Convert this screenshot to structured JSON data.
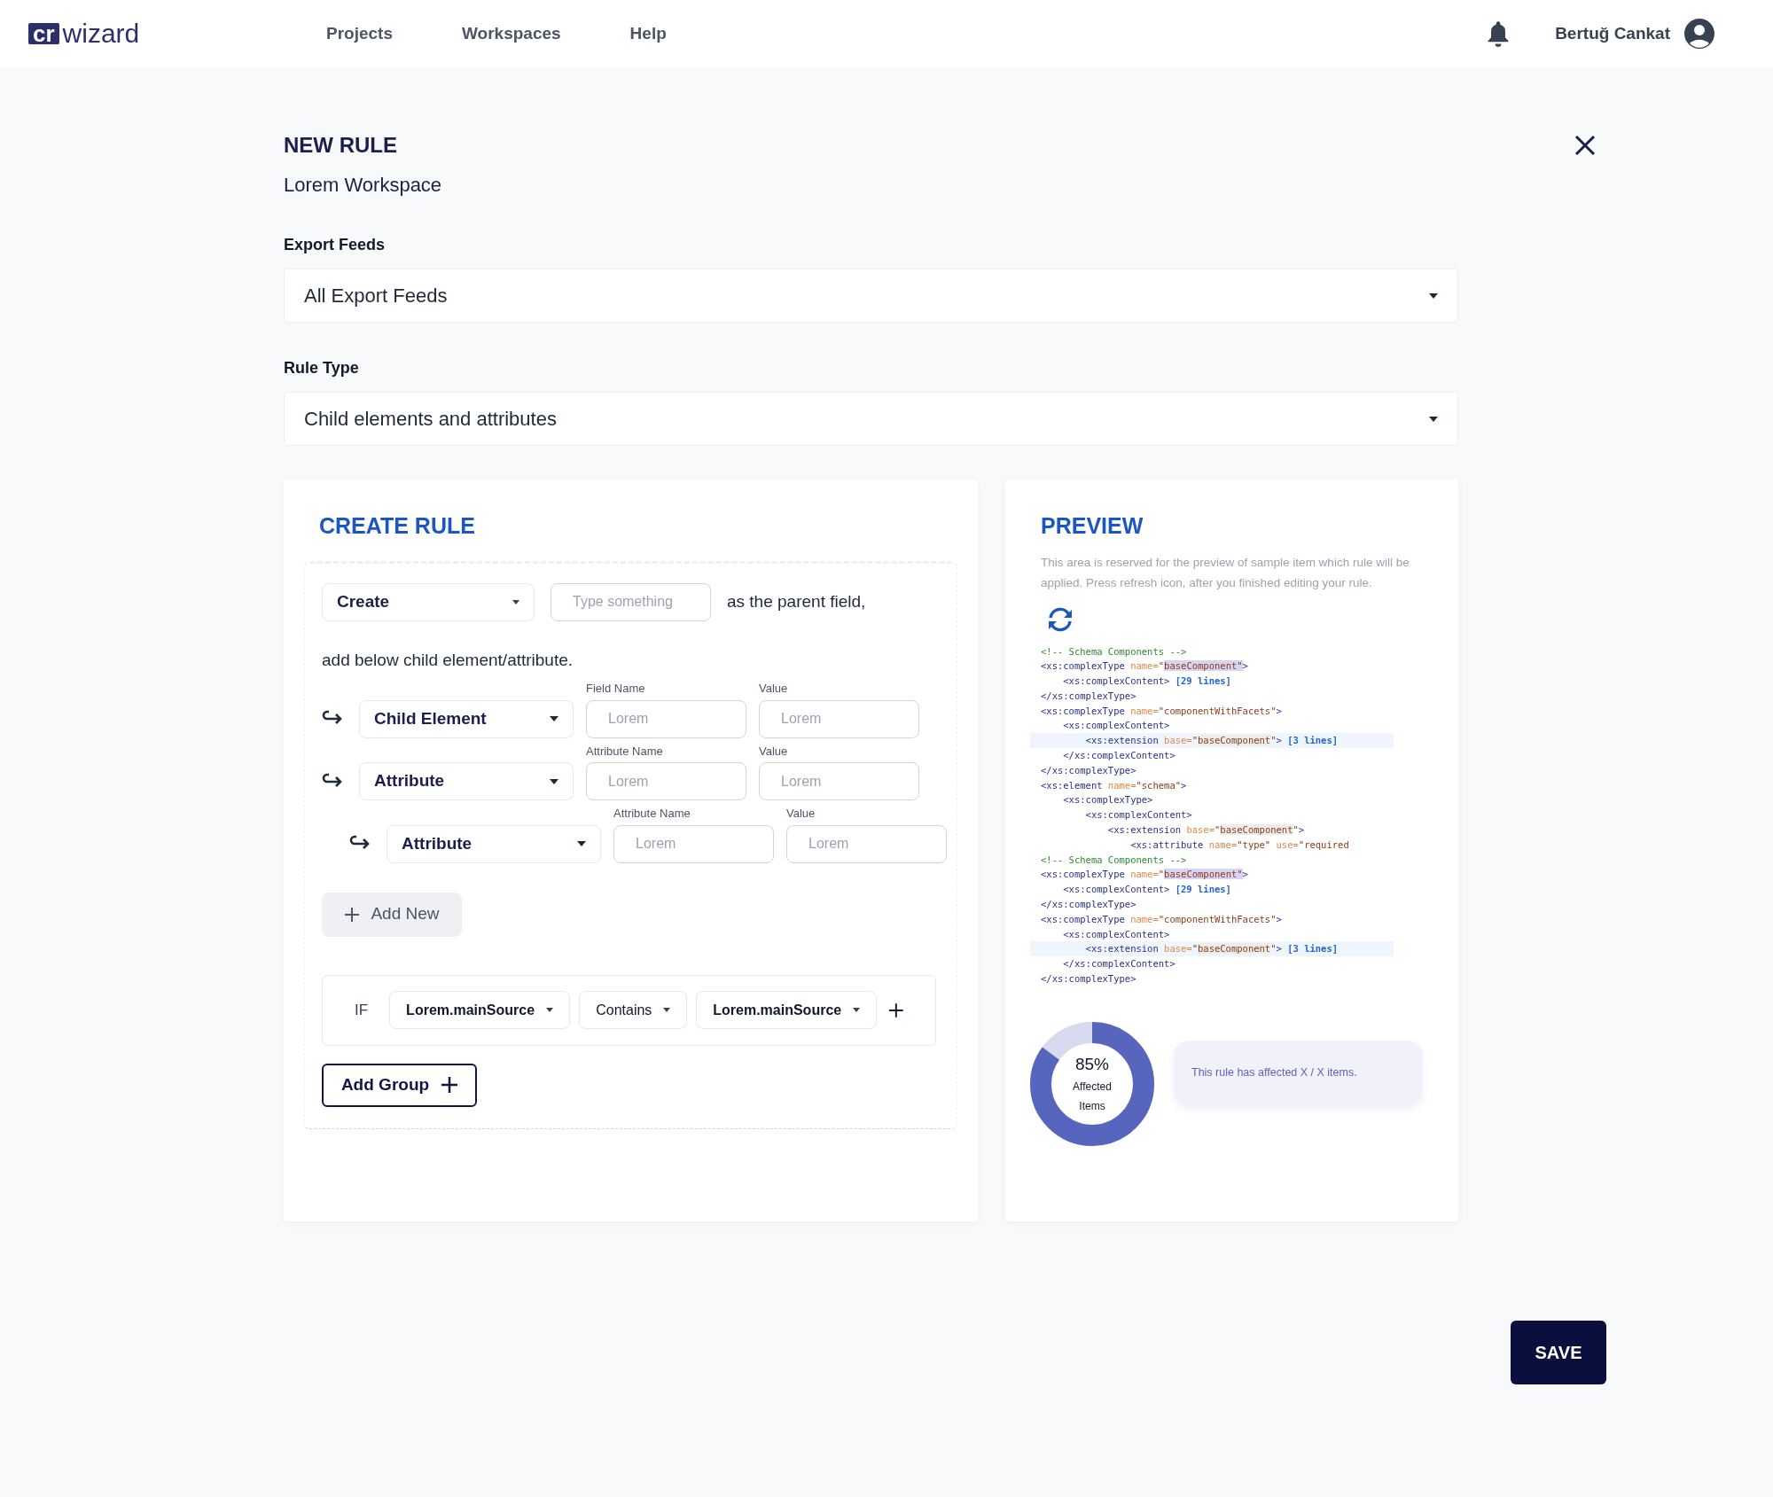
{
  "header": {
    "logo": {
      "badge": "cr",
      "word": "wizard"
    },
    "nav": [
      "Projects",
      "Workspaces",
      "Help"
    ],
    "user": "Bertuğ Cankat"
  },
  "page": {
    "title": "NEW RULE",
    "subtitle": "Lorem Workspace"
  },
  "fields": [
    {
      "label": "Export Feeds",
      "value": "All Export Feeds"
    },
    {
      "label": "Rule Type",
      "value": "Child elements and attributes"
    }
  ],
  "create_rule": {
    "title": "CREATE RULE",
    "action": "Create",
    "parent_placeholder": "Type something",
    "parent_text": "as the parent field,",
    "instruction": "add below child element/attribute.",
    "rows": [
      {
        "type": "Child Element",
        "name_label": "Field Name",
        "name_placeholder": "Lorem",
        "value_label": "Value",
        "value_placeholder": "Lorem"
      },
      {
        "type": "Attribute",
        "name_label": "Attribute Name",
        "name_placeholder": "Lorem",
        "value_label": "Value",
        "value_placeholder": "Lorem",
        "children": [
          {
            "type": "Attribute",
            "name_label": "Attribute Name",
            "name_placeholder": "Lorem",
            "value_label": "Value",
            "value_placeholder": "Lorem"
          }
        ]
      }
    ],
    "add_new": "Add New",
    "condition": {
      "keyword": "IF",
      "field": "Lorem.mainSource",
      "operator": "Contains",
      "value": "Lorem.mainSource"
    },
    "add_group": "Add Group"
  },
  "preview": {
    "title": "PREVIEW",
    "description": "This area is reserved for the preview of sample item which rule will be applied. Press refresh icon, after you finished editing your rule.",
    "code": [
      {
        "highlighted": false,
        "tokens": [
          {
            "kind": "comment",
            "text": "<!-- Schema Components -->"
          }
        ]
      },
      {
        "highlighted": false,
        "tokens": [
          {
            "kind": "tag",
            "text": "<xs:complexType "
          },
          {
            "kind": "attr",
            "text": "name="
          },
          {
            "kind": "value",
            "text": "\""
          },
          {
            "kind": "selected",
            "text": "baseComponent\""
          },
          {
            "kind": "tag",
            "text": ">"
          }
        ]
      },
      {
        "highlighted": false,
        "tokens": [
          {
            "kind": "tag",
            "text": "    <xs:complexContent>"
          },
          {
            "kind": "fold",
            "text": " [29 lines]"
          }
        ]
      },
      {
        "highlighted": false,
        "tokens": [
          {
            "kind": "tag",
            "text": "</xs:complexType>"
          }
        ]
      },
      {
        "highlighted": false,
        "tokens": [
          {
            "kind": "tag",
            "text": "<xs:complexType "
          },
          {
            "kind": "attr",
            "text": "name="
          },
          {
            "kind": "value",
            "text": "\"componentWithFacets\""
          },
          {
            "kind": "tag",
            "text": ">"
          }
        ]
      },
      {
        "highlighted": false,
        "tokens": [
          {
            "kind": "tag",
            "text": "    <xs:complexContent>"
          }
        ]
      },
      {
        "highlighted": true,
        "tokens": [
          {
            "kind": "tag",
            "text": "        <xs:extension "
          },
          {
            "kind": "attr",
            "text": "base="
          },
          {
            "kind": "value",
            "text": "\""
          },
          {
            "kind": "marked",
            "text": "baseComponent"
          },
          {
            "kind": "value",
            "text": "\""
          },
          {
            "kind": "tag",
            "text": ">"
          },
          {
            "kind": "fold",
            "text": " [3 lines]"
          }
        ]
      },
      {
        "highlighted": false,
        "tokens": [
          {
            "kind": "tag",
            "text": "    </xs:complexContent>"
          }
        ]
      },
      {
        "highlighted": false,
        "tokens": [
          {
            "kind": "tag",
            "text": "</xs:complexType>"
          }
        ]
      },
      {
        "highlighted": false,
        "tokens": [
          {
            "kind": "tag",
            "text": "<xs:element "
          },
          {
            "kind": "attr",
            "text": "name="
          },
          {
            "kind": "value",
            "text": "\"schema\""
          },
          {
            "kind": "tag",
            "text": ">"
          }
        ]
      },
      {
        "highlighted": false,
        "tokens": [
          {
            "kind": "tag",
            "text": "    <xs:complexType>"
          }
        ]
      },
      {
        "highlighted": false,
        "tokens": [
          {
            "kind": "tag",
            "text": "        <xs:complexContent>"
          }
        ]
      },
      {
        "highlighted": false,
        "tokens": [
          {
            "kind": "tag",
            "text": "            <xs:extension "
          },
          {
            "kind": "attr",
            "text": "base="
          },
          {
            "kind": "value",
            "text": "\""
          },
          {
            "kind": "marked",
            "text": "baseComponent"
          },
          {
            "kind": "value",
            "text": "\""
          },
          {
            "kind": "tag",
            "text": ">"
          }
        ]
      },
      {
        "highlighted": false,
        "tokens": [
          {
            "kind": "tag",
            "text": "                <xs:attribute "
          },
          {
            "kind": "attr",
            "text": "name="
          },
          {
            "kind": "value",
            "text": "\"type\""
          },
          {
            "kind": "attr",
            "text": " use="
          },
          {
            "kind": "value",
            "text": "\"required"
          }
        ]
      },
      {
        "highlighted": false,
        "tokens": [
          {
            "kind": "comment",
            "text": "<!-- Schema Components -->"
          }
        ]
      },
      {
        "highlighted": false,
        "tokens": [
          {
            "kind": "tag",
            "text": "<xs:complexType "
          },
          {
            "kind": "attr",
            "text": "name="
          },
          {
            "kind": "value",
            "text": "\""
          },
          {
            "kind": "selected",
            "text": "baseComponent\""
          },
          {
            "kind": "tag",
            "text": ">"
          }
        ]
      },
      {
        "highlighted": false,
        "tokens": [
          {
            "kind": "tag",
            "text": "    <xs:complexContent>"
          },
          {
            "kind": "fold",
            "text": " [29 lines]"
          }
        ]
      },
      {
        "highlighted": false,
        "tokens": [
          {
            "kind": "tag",
            "text": "</xs:complexType>"
          }
        ]
      },
      {
        "highlighted": false,
        "tokens": [
          {
            "kind": "tag",
            "text": "<xs:complexType "
          },
          {
            "kind": "attr",
            "text": "name="
          },
          {
            "kind": "value",
            "text": "\"componentWithFacets\""
          },
          {
            "kind": "tag",
            "text": ">"
          }
        ]
      },
      {
        "highlighted": false,
        "tokens": [
          {
            "kind": "tag",
            "text": "    <xs:complexContent>"
          }
        ]
      },
      {
        "highlighted": true,
        "tokens": [
          {
            "kind": "tag",
            "text": "        <xs:extension "
          },
          {
            "kind": "attr",
            "text": "base="
          },
          {
            "kind": "value",
            "text": "\""
          },
          {
            "kind": "marked",
            "text": "baseComponent"
          },
          {
            "kind": "value",
            "text": "\""
          },
          {
            "kind": "tag",
            "text": ">"
          },
          {
            "kind": "fold",
            "text": " [3 lines]"
          }
        ]
      },
      {
        "highlighted": false,
        "tokens": [
          {
            "kind": "tag",
            "text": "    </xs:complexContent>"
          }
        ]
      },
      {
        "highlighted": false,
        "tokens": [
          {
            "kind": "tag",
            "text": "</xs:complexType>"
          }
        ]
      }
    ],
    "donut": {
      "percent": "85%",
      "label": "Affected Items",
      "level": 0.85
    },
    "summary": "This rule has affected X / X items."
  },
  "save": "SAVE"
}
